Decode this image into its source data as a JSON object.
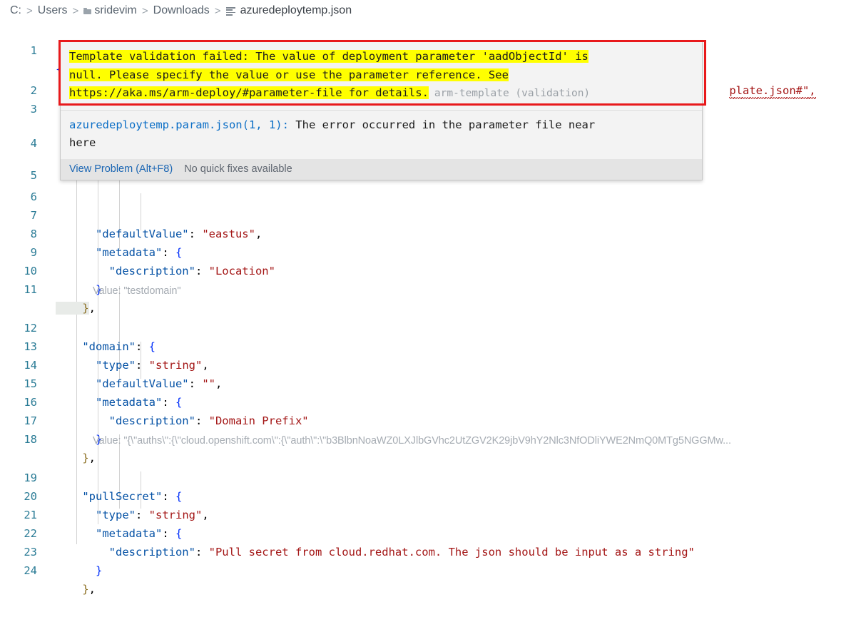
{
  "breadcrumb": {
    "items": [
      {
        "label": "C:",
        "icon": null
      },
      {
        "label": "Users",
        "icon": null
      },
      {
        "label": "sridevim",
        "icon": "folder-icon"
      },
      {
        "label": "Downloads",
        "icon": null
      },
      {
        "label": "azuredeploytemp.json",
        "icon": "json-file-icon"
      }
    ],
    "separator": ">"
  },
  "editor": {
    "language": "json",
    "lines": [
      {
        "num": "1",
        "text": "{"
      },
      {
        "num": "2",
        "text": ""
      },
      {
        "num": "3",
        "text": ""
      },
      {
        "num": "4",
        "text": ""
      },
      {
        "num": "5",
        "text": ""
      },
      {
        "num": "6",
        "text": ""
      },
      {
        "num": "7",
        "text": "      \"defaultValue\": \"eastus\","
      },
      {
        "num": "8",
        "text": "      \"metadata\": {"
      },
      {
        "num": "9",
        "text": "        \"description\": \"Location\""
      },
      {
        "num": "10",
        "text": "      }"
      },
      {
        "num": "11",
        "text": "    },"
      },
      {
        "num": "12",
        "text": "    \"domain\": {"
      },
      {
        "num": "13",
        "text": "      \"type\": \"string\","
      },
      {
        "num": "14",
        "text": "      \"defaultValue\": \"\","
      },
      {
        "num": "15",
        "text": "      \"metadata\": {"
      },
      {
        "num": "16",
        "text": "        \"description\": \"Domain Prefix\""
      },
      {
        "num": "17",
        "text": "      }"
      },
      {
        "num": "18",
        "text": "    },"
      },
      {
        "num": "19",
        "text": "    \"pullSecret\": {"
      },
      {
        "num": "20",
        "text": "      \"type\": \"string\","
      },
      {
        "num": "21",
        "text": "      \"metadata\": {"
      },
      {
        "num": "22",
        "text": "        \"description\": \"Pull secret from cloud.redhat.com. The json should be input as a string\""
      },
      {
        "num": "23",
        "text": "      }"
      },
      {
        "num": "24",
        "text": "    },"
      }
    ],
    "schema_line_tail": "plate.json#\",",
    "inlay_hints": [
      {
        "after_line": "11",
        "text": "Value: \"testdomain\""
      },
      {
        "after_line": "18",
        "text": "Value: \"{\\\"auths\\\":{\\\"cloud.openshift.com\\\":{\\\"auth\\\":\\\"b3BlbnNoaWZ0LXJlbGVhc2UtZGV2K29jbV9hY2Nlc3NfODliYWE2NmQ0MTg5NGGMw..."
      }
    ]
  },
  "hover_tooltip": {
    "message_prefix": "Template validation failed: The value of deployment parameter 'aadObjectId' is null. Please specify the value or use the parameter reference. See https://aka.ms/arm-deploy/#parameter-file for details.",
    "message_line1": "Template validation failed: The value of deployment parameter 'aadObjectId' is",
    "message_line2": "null. Please specify the value or use the parameter reference. See",
    "message_line3": "https://aka.ms/arm-deploy/#parameter-file for details.",
    "source_tag": "arm-template (validation)",
    "secondary_line1": "azuredeploytemp.param.json(1, 1): The error occurred in the parameter file near",
    "secondary_line2": "here",
    "secondary_filename": "azuredeploytemp.param.json(1, 1):",
    "secondary_rest": " The error occurred in the parameter file near",
    "actions": {
      "view_problem": "View Problem (Alt+F8)",
      "quick_fix": "No quick fixes available"
    }
  },
  "annotation": {
    "type": "red-rectangle-highlight",
    "color": "#e8191b"
  },
  "colors": {
    "highlight_yellow": "#ffff00",
    "json_key": "#0451a5",
    "json_string": "#a31515",
    "line_number": "#2b7c96",
    "tooltip_bg": "#f3f3f3",
    "tooltip_action_bg": "#e4e4e4",
    "link_blue": "#1b66b3",
    "annotation_red": "#e8191b"
  }
}
